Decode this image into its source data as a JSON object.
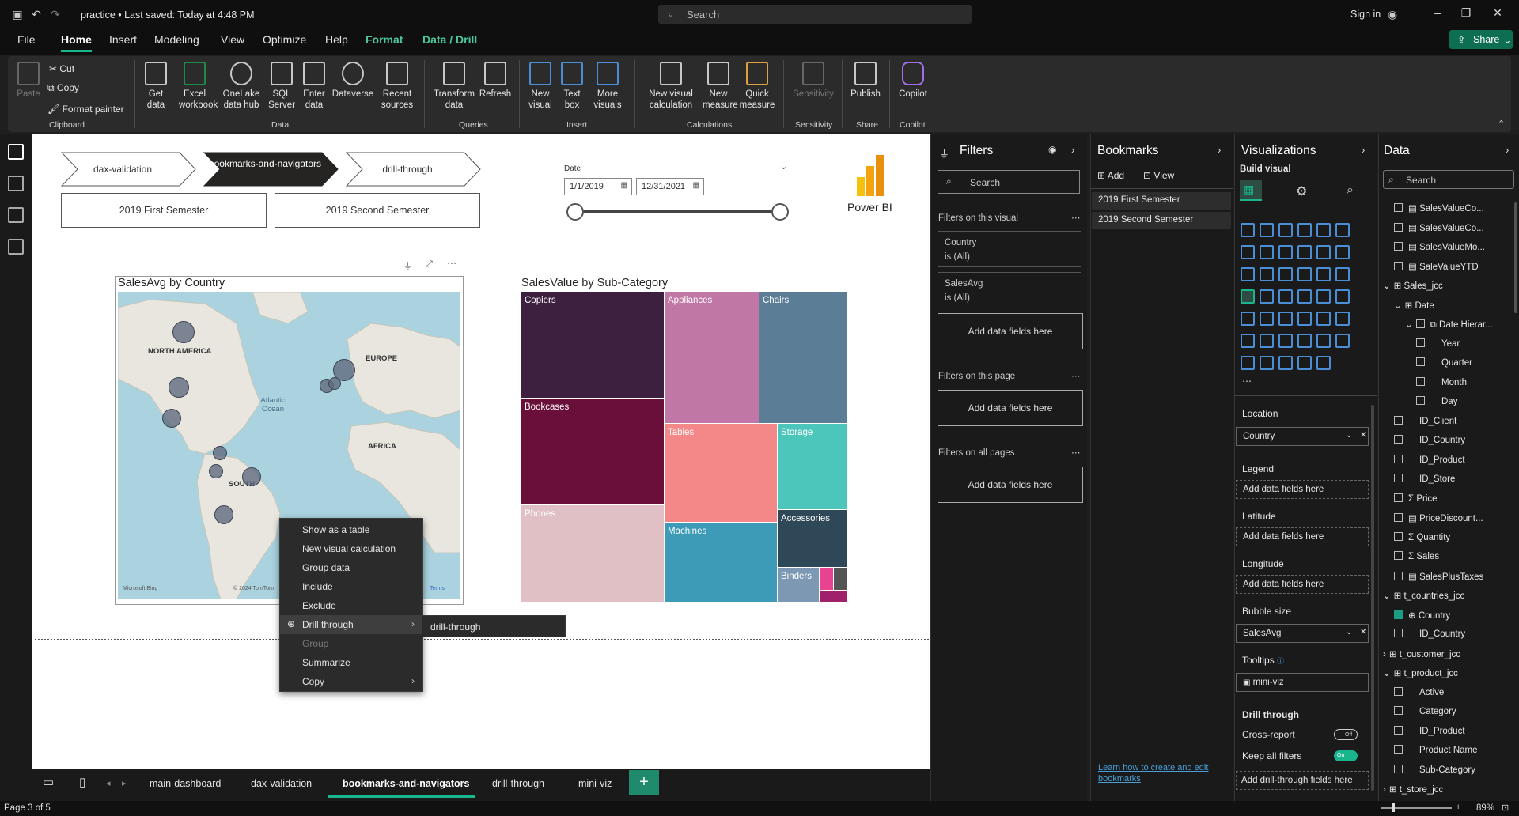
{
  "titlebar": {
    "title": "practice • Last saved: Today at 4:48 PM",
    "search": "Search",
    "signin": "Sign in"
  },
  "menu": {
    "file": "File",
    "home": "Home",
    "insert": "Insert",
    "modeling": "Modeling",
    "view": "View",
    "optimize": "Optimize",
    "help": "Help",
    "format": "Format",
    "data_drill": "Data / Drill",
    "share": "Share"
  },
  "ribbon": {
    "clipboard": {
      "paste": "Paste",
      "cut": "Cut",
      "copy": "Copy",
      "format_painter": "Format painter",
      "group": "Clipboard"
    },
    "data": {
      "get_data": "Get data",
      "excel": "Excel workbook",
      "onelake": "OneLake data hub",
      "sql": "SQL Server",
      "enter": "Enter data",
      "dataverse": "Dataverse",
      "recent": "Recent sources",
      "group": "Data"
    },
    "queries": {
      "transform": "Transform data",
      "refresh": "Refresh",
      "group": "Queries"
    },
    "insert": {
      "new_visual": "New visual",
      "text_box": "Text box",
      "more_visuals": "More visuals",
      "group": "Insert"
    },
    "calculations": {
      "new_visual_calc": "New visual calculation",
      "new_measure": "New measure",
      "quick_measure": "Quick measure",
      "group": "Calculations"
    },
    "sensitivity": {
      "label": "Sensitivity",
      "group": "Sensitivity"
    },
    "share": {
      "publish": "Publish",
      "group": "Share"
    },
    "copilot": {
      "label": "Copilot",
      "group": "Copilot"
    }
  },
  "canvas": {
    "nav_buttons": [
      "dax-validation",
      "bookmarks-and-navigators",
      "drill-through"
    ],
    "semester_buttons": [
      "2019 First Semester",
      "2019 Second Semester"
    ],
    "date_slicer": {
      "label": "Date",
      "start": "1/1/2019",
      "end": "12/31/2021"
    },
    "logo_text": "Power BI",
    "map": {
      "title": "SalesAvg by Country",
      "labels": {
        "north_america": "NORTH AMERICA",
        "europe": "EUROPE",
        "africa": "AFRICA",
        "south": "SOUTH",
        "ocean": "Atlantic Ocean"
      },
      "attribution": "Microsoft Bing",
      "copyright": "© 2024 TomTom",
      "terms": "Terms"
    },
    "treemap": {
      "title": "SalesValue by Sub-Category",
      "tiles": [
        "Copiers",
        "Appliances",
        "Chairs",
        "Bookcases",
        "Tables",
        "Storage",
        "Phones",
        "Machines",
        "Accessories",
        "Binders"
      ]
    }
  },
  "context_menu": {
    "items": [
      "Show as a table",
      "New visual calculation",
      "Group data",
      "Include",
      "Exclude",
      "Drill through",
      "Group",
      "Summarize",
      "Copy"
    ],
    "submenu": "drill-through"
  },
  "filters": {
    "title": "Filters",
    "search": "Search",
    "on_visual": "Filters on this visual",
    "country_card": {
      "name": "Country",
      "value": "is (All)"
    },
    "salesavg_card": {
      "name": "SalesAvg",
      "value": "is (All)"
    },
    "add_fields": "Add data fields here",
    "on_page": "Filters on this page",
    "on_all": "Filters on all pages"
  },
  "bookmarks": {
    "title": "Bookmarks",
    "add": "Add",
    "view": "View",
    "items": [
      "2019 First Semester",
      "2019 Second Semester"
    ],
    "learn_link": "Learn how to create and edit bookmarks"
  },
  "visualizations": {
    "title": "Visualizations",
    "build": "Build visual",
    "location": "Location",
    "location_value": "Country",
    "legend": "Legend",
    "latitude": "Latitude",
    "longitude": "Longitude",
    "bubble_size": "Bubble size",
    "bubble_value": "SalesAvg",
    "tooltips": "Tooltips",
    "tooltip_value": "mini-viz",
    "add_fields": "Add data fields here",
    "drill_through": "Drill through",
    "cross_report": "Cross-report",
    "cross_report_state": "Off",
    "keep_filters": "Keep all filters",
    "keep_filters_state": "On",
    "add_drill": "Add drill-through fields here"
  },
  "data_pane": {
    "title": "Data",
    "search": "Search",
    "items": [
      {
        "label": "SalesValueCo...",
        "indent": 1,
        "kind": "measure"
      },
      {
        "label": "SalesValueCo...",
        "indent": 1,
        "kind": "measure"
      },
      {
        "label": "SalesValueMo...",
        "indent": 1,
        "kind": "measure"
      },
      {
        "label": "SaleValueYTD",
        "indent": 1,
        "kind": "measure"
      },
      {
        "label": "Sales_jcc",
        "indent": 0,
        "kind": "table"
      },
      {
        "label": "Date",
        "indent": 1,
        "kind": "table"
      },
      {
        "label": "Date Hierar...",
        "indent": 2,
        "kind": "hier"
      },
      {
        "label": "Year",
        "indent": 3,
        "kind": "field"
      },
      {
        "label": "Quarter",
        "indent": 3,
        "kind": "field"
      },
      {
        "label": "Month",
        "indent": 3,
        "kind": "field"
      },
      {
        "label": "Day",
        "indent": 3,
        "kind": "field"
      },
      {
        "label": "ID_Client",
        "indent": 1,
        "kind": "field"
      },
      {
        "label": "ID_Country",
        "indent": 1,
        "kind": "field"
      },
      {
        "label": "ID_Product",
        "indent": 1,
        "kind": "field"
      },
      {
        "label": "ID_Store",
        "indent": 1,
        "kind": "field"
      },
      {
        "label": "Price",
        "indent": 1,
        "kind": "sum"
      },
      {
        "label": "PriceDiscount...",
        "indent": 1,
        "kind": "measure"
      },
      {
        "label": "Quantity",
        "indent": 1,
        "kind": "sum"
      },
      {
        "label": "Sales",
        "indent": 1,
        "kind": "sum"
      },
      {
        "label": "SalesPlusTaxes",
        "indent": 1,
        "kind": "measure"
      },
      {
        "label": "t_countries_jcc",
        "indent": 0,
        "kind": "table"
      },
      {
        "label": "Country",
        "indent": 1,
        "kind": "geo",
        "checked": true
      },
      {
        "label": "ID_Country",
        "indent": 1,
        "kind": "field"
      },
      {
        "label": "t_customer_jcc",
        "indent": 0,
        "kind": "table-collapsed"
      },
      {
        "label": "t_product_jcc",
        "indent": 0,
        "kind": "table"
      },
      {
        "label": "Active",
        "indent": 1,
        "kind": "field"
      },
      {
        "label": "Category",
        "indent": 1,
        "kind": "field"
      },
      {
        "label": "ID_Product",
        "indent": 1,
        "kind": "field"
      },
      {
        "label": "Product Name",
        "indent": 1,
        "kind": "field"
      },
      {
        "label": "Sub-Category",
        "indent": 1,
        "kind": "field"
      },
      {
        "label": "t_store_jcc",
        "indent": 0,
        "kind": "table-collapsed"
      }
    ]
  },
  "pages": {
    "tabs": [
      "main-dashboard",
      "dax-validation",
      "bookmarks-and-navigators",
      "drill-through",
      "mini-viz"
    ],
    "active": "bookmarks-and-navigators",
    "status": "Page 3 of 5",
    "zoom": "89%"
  },
  "colors": {
    "accent": "#19b58d",
    "copiers": "#3d1f3f",
    "appliances": "#c077a5",
    "chairs": "#5b7d96",
    "bookcases": "#6a0f3a",
    "tables": "#f48787",
    "storage": "#4cc5bb",
    "phones": "#e0c0c4",
    "machines": "#3d9bb8",
    "accessories": "#2f4858"
  }
}
